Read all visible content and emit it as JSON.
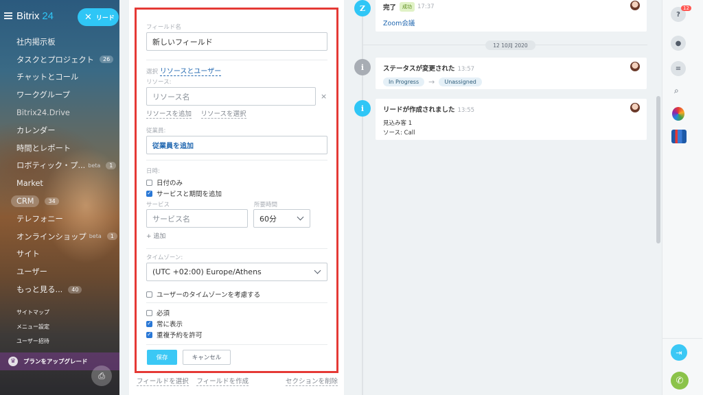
{
  "app": {
    "logo": "Bitrix",
    "logo_num": "24"
  },
  "sidebar": {
    "close_chip": "リード",
    "items": [
      {
        "label": "社内掲示板",
        "badge": ""
      },
      {
        "label": "タスクとプロジェクト",
        "badge": "26"
      },
      {
        "label": "チャットとコール",
        "badge": ""
      },
      {
        "label": "ワークグループ",
        "badge": ""
      },
      {
        "label": "Bitrix24.Drive",
        "badge": ""
      },
      {
        "label": "カレンダー",
        "badge": ""
      },
      {
        "label": "時間とレポート",
        "badge": ""
      },
      {
        "label": "ロボティック・プ...",
        "badge": "1",
        "beta": "beta"
      },
      {
        "label": "Market",
        "badge": ""
      },
      {
        "label": "CRM",
        "badge": "34"
      },
      {
        "label": "テレフォニー",
        "badge": ""
      },
      {
        "label": "オンラインショップ",
        "badge": "1",
        "beta": "beta"
      },
      {
        "label": "サイト",
        "badge": ""
      },
      {
        "label": "ユーザー",
        "badge": ""
      },
      {
        "label": "もっと見る...",
        "badge": "40"
      }
    ],
    "small_links": [
      "サイトマップ",
      "メニュー設定",
      "ユーザー招待"
    ],
    "upgrade": "プランをアップグレード"
  },
  "form": {
    "field_name_label": "フィールド名",
    "field_name_value": "新しいフィールド",
    "select_prefix": "選択",
    "select_link": "リソースとユーザー",
    "resource_label": "リソース:",
    "resource_placeholder": "リソース名",
    "add_resource": "リソースを追加",
    "select_resource": "リソースを選択",
    "employee_label": "従業員:",
    "add_employee": "従業員を追加",
    "datetime_label": "日時:",
    "date_only": "日付のみ",
    "add_service": "サービスと期間を追加",
    "service_label": "サービス",
    "duration_label": "所要時間",
    "service_placeholder": "サービス名",
    "duration_value": "60分",
    "add": "+ 追加",
    "timezone_label": "タイムゾーン:",
    "timezone_value": "(UTC +02:00) Europe/Athens",
    "consider_tz": "ユーザーのタイムゾーンを考慮する",
    "required": "必須",
    "always_show": "常に表示",
    "allow_overlap": "重複予約を許可",
    "save": "保存",
    "cancel": "キャンセル",
    "select_field": "フィールドを選択",
    "create_field": "フィールドを作成",
    "delete_section": "セクションを削除"
  },
  "timeline": {
    "items": [
      {
        "title": "完了",
        "status": "成功",
        "time": "17:37",
        "body": "Zoom会議"
      },
      {
        "title": "ステータスが変更された",
        "time": "13:57",
        "from": "In Progress",
        "to": "Unassigned"
      },
      {
        "title": "リードが作成されました",
        "time": "13:55",
        "line1": "見込み客 1",
        "line2": "ソース: Call"
      }
    ],
    "date_chip": "12 10月 2020"
  },
  "rightbar": {
    "help_badge": "12"
  },
  "colors": {
    "accent": "#2fc6f6",
    "highlight": "#e53935",
    "link": "#2067b0"
  }
}
